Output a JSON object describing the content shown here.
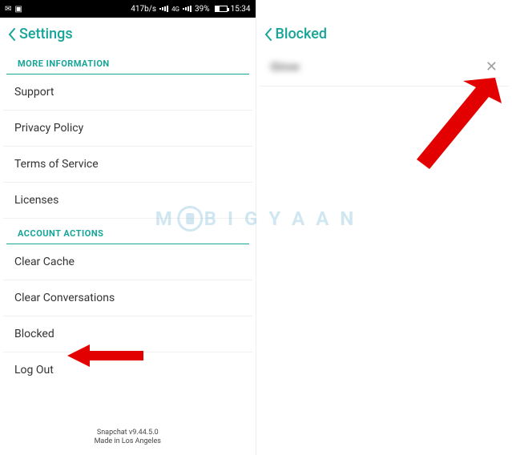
{
  "status_bar": {
    "speed": "417b/s",
    "network_type": "4G",
    "battery_percent": "39%",
    "time": "15:34"
  },
  "left": {
    "header_title": "Settings",
    "section1_title": "MORE INFORMATION",
    "section1_items": [
      "Support",
      "Privacy Policy",
      "Terms of Service",
      "Licenses"
    ],
    "section2_title": "ACCOUNT ACTIONS",
    "section2_items": [
      "Clear Cache",
      "Clear Conversations",
      "Blocked",
      "Log Out"
    ],
    "footer_line1": "Snapchat v9.44.5.0",
    "footer_line2": "Made in Los Angeles"
  },
  "right": {
    "header_title": "Blocked",
    "blocked_user": "Girow"
  },
  "watermark": {
    "pre": "M",
    "post": "B I G Y A A N"
  }
}
